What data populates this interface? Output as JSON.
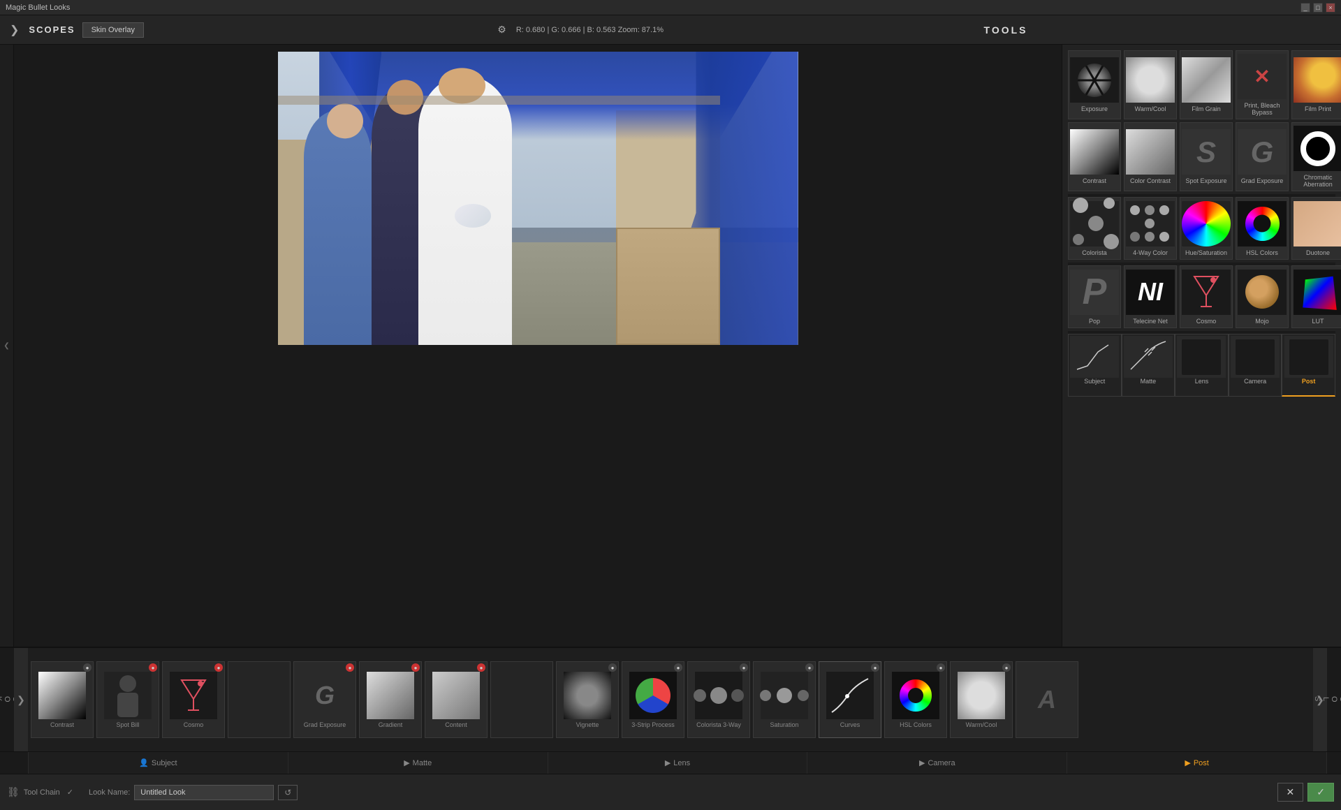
{
  "app": {
    "title": "Magic Bullet Looks",
    "title_display": "Magic Bullet Looks"
  },
  "titlebar": {
    "controls": [
      "_",
      "□",
      "×"
    ]
  },
  "topbar": {
    "scopes_label": "SCOPES",
    "skin_overlay": "Skin Overlay",
    "color_info": "R: 0.680  |  G: 0.666  |  B: 0.563    Zoom: 87.1%",
    "tools_label": "TOOLS"
  },
  "tools": {
    "rows": [
      {
        "items": [
          {
            "id": "exposure",
            "label": "Exposure",
            "thumb": "aperture"
          },
          {
            "id": "warmcool",
            "label": "Warm/Cool",
            "thumb": "warmcool"
          },
          {
            "id": "filmgrain",
            "label": "Film Grain",
            "thumb": "filmgrain"
          },
          {
            "id": "printbleach",
            "label": "Print, Bleach Bypass",
            "thumb": "printbleach"
          },
          {
            "id": "filmprint",
            "label": "Film Print",
            "thumb": "filmprint"
          }
        ]
      },
      {
        "items": [
          {
            "id": "contrast",
            "label": "Contrast",
            "thumb": "contrast"
          },
          {
            "id": "colorcontrast",
            "label": "Color Contrast",
            "thumb": "colorcontrast"
          },
          {
            "id": "spotexposure",
            "label": "Spot Exposure",
            "thumb": "spotexposure"
          },
          {
            "id": "gradexposure",
            "label": "Grad Exposure",
            "thumb": "gradexposure"
          },
          {
            "id": "chromaticaberration",
            "label": "Chromatic Aberration",
            "thumb": "chromatic"
          }
        ]
      },
      {
        "items": [
          {
            "id": "colorista",
            "label": "Colorista",
            "thumb": "colorista"
          },
          {
            "id": "4waycolor",
            "label": "4-Way Color",
            "thumb": "4way"
          },
          {
            "id": "huesaturation",
            "label": "Hue/Saturation",
            "thumb": "huesat"
          },
          {
            "id": "hslcolors",
            "label": "HSL Colors",
            "thumb": "hslcolors"
          },
          {
            "id": "duotone",
            "label": "Duotone",
            "thumb": "duotone"
          }
        ]
      },
      {
        "items": [
          {
            "id": "pop",
            "label": "Pop",
            "thumb": "pop"
          },
          {
            "id": "telecine",
            "label": "Telecine Net",
            "thumb": "telecine"
          },
          {
            "id": "cosmo",
            "label": "Cosmo",
            "thumb": "cosmo"
          },
          {
            "id": "mojo",
            "label": "Mojo",
            "thumb": "mojo"
          },
          {
            "id": "lut",
            "label": "LUT",
            "thumb": "lut"
          }
        ]
      }
    ],
    "segments": [
      {
        "id": "subject",
        "label": "Subject"
      },
      {
        "id": "matte",
        "label": "Matte"
      },
      {
        "id": "lens",
        "label": "Lens"
      },
      {
        "id": "camera",
        "label": "Camera"
      },
      {
        "id": "post",
        "label": "Post",
        "active": true
      }
    ]
  },
  "strip": {
    "items": [
      {
        "id": "contrast-strip",
        "label": "Contrast",
        "has_close": true,
        "close_type": "normal"
      },
      {
        "id": "spotbill-strip",
        "label": "Spot Bill",
        "has_close": true,
        "close_type": "red"
      },
      {
        "id": "cosmo-strip",
        "label": "Cosmo",
        "has_close": true,
        "close_type": "red"
      },
      {
        "id": "gap1",
        "label": "",
        "is_empty": true
      },
      {
        "id": "gradexposure-strip",
        "label": "Grad Exposure",
        "has_close": true,
        "close_type": "red"
      },
      {
        "id": "gradient-strip",
        "label": "Gradient",
        "has_close": true,
        "close_type": "red"
      },
      {
        "id": "content-strip",
        "label": "Content",
        "has_close": true,
        "close_type": "red"
      },
      {
        "id": "gap2",
        "label": "",
        "is_empty": true
      },
      {
        "id": "vignette-strip",
        "label": "Vignette",
        "has_close": true,
        "close_type": "normal"
      },
      {
        "id": "3stripprocess-strip",
        "label": "3-Strip Process",
        "has_close": true,
        "close_type": "normal"
      },
      {
        "id": "colorista3way-strip",
        "label": "Colorista 3-Way",
        "has_close": true,
        "close_type": "normal"
      },
      {
        "id": "saturation-strip",
        "label": "Saturation",
        "has_close": true,
        "close_type": "normal"
      },
      {
        "id": "curves-strip",
        "label": "Curves",
        "has_close": true,
        "close_type": "normal"
      },
      {
        "id": "hslcolors-strip",
        "label": "HSL Colors",
        "has_close": true,
        "close_type": "normal"
      },
      {
        "id": "warmcool-strip",
        "label": "Warm/Cool",
        "has_close": true,
        "close_type": "normal"
      },
      {
        "id": "a-strip",
        "label": "A",
        "is_empty": false
      }
    ]
  },
  "sections_bar": {
    "items": [
      {
        "id": "subject-bar",
        "label": "Subject",
        "icon": "👤"
      },
      {
        "id": "matte-bar",
        "label": "Matte",
        "icon": "▶"
      },
      {
        "id": "lens-bar",
        "label": "Lens",
        "icon": "▶"
      },
      {
        "id": "camera-bar",
        "label": "Camera",
        "icon": "▶"
      },
      {
        "id": "post-bar",
        "label": "Post",
        "icon": "▶",
        "active": true
      }
    ]
  },
  "toolbar": {
    "chain_label": "Tool Chain",
    "look_name_label": "Look Name:",
    "look_name_value": "Untitled Look",
    "reset_label": "↺",
    "cancel_label": "✕",
    "apply_label": "✓"
  }
}
